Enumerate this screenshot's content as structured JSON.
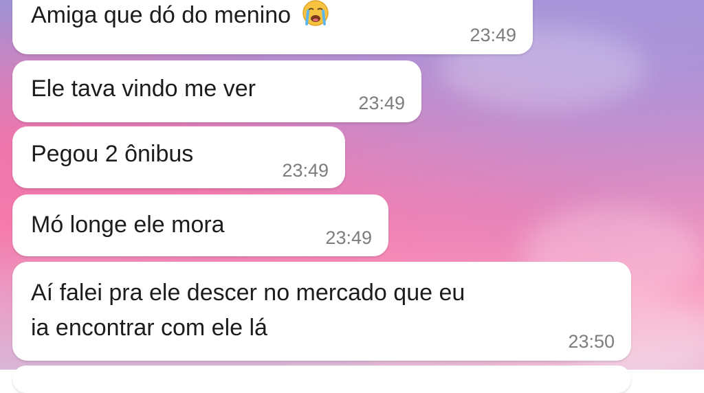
{
  "messages": [
    {
      "text": "Amiga que dó do menino",
      "emoji": "loudly-crying-face-icon",
      "time": "23:49"
    },
    {
      "text": "Ele tava vindo me ver",
      "time": "23:49"
    },
    {
      "text": "Pegou 2 ônibus",
      "time": "23:49"
    },
    {
      "text": "Mó longe ele mora",
      "time": "23:49"
    },
    {
      "text_line1": "Aí falei pra ele descer no mercado que eu",
      "text_line2": "ia encontrar com ele lá",
      "time": "23:50"
    }
  ],
  "colors": {
    "bubble": "#ffffff",
    "text": "#1c1c1c",
    "timestamp": "#7d7d7d"
  }
}
